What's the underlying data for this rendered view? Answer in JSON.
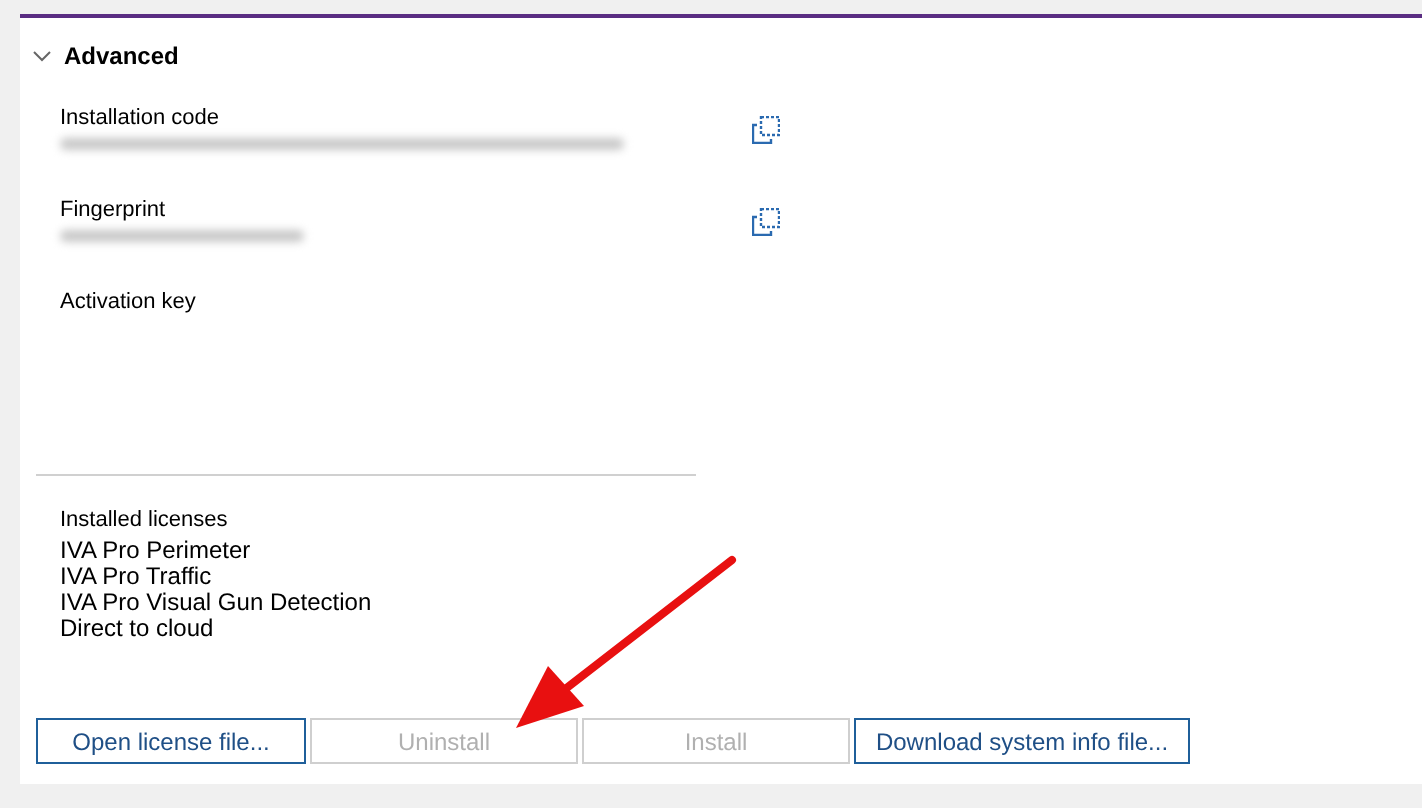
{
  "section": {
    "title": "Advanced",
    "expanded": true
  },
  "fields": [
    {
      "kind": "code",
      "label": "Installation code"
    },
    {
      "kind": "code",
      "label": "Fingerprint"
    },
    {
      "kind": "input",
      "label": "Activation key"
    }
  ],
  "installed_licenses": {
    "label": "Installed licenses",
    "items": [
      "IVA Pro Perimeter",
      "IVA Pro Traffic",
      "IVA Pro Visual Gun Detection",
      "Direct to cloud"
    ]
  },
  "buttons": [
    {
      "label": "Open license file...",
      "disabled": false
    },
    {
      "label": "Uninstall",
      "disabled": true
    },
    {
      "label": "Install",
      "disabled": true
    },
    {
      "label": "Download system info file...",
      "disabled": false
    }
  ],
  "annotations": [
    {
      "kind": "arrow"
    }
  ]
}
